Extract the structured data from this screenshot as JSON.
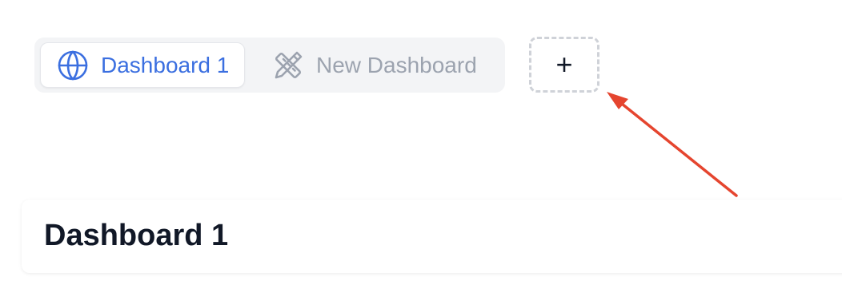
{
  "tabs": [
    {
      "label": "Dashboard 1",
      "icon": "globe-icon",
      "active": true
    },
    {
      "label": "New Dashboard",
      "icon": "pencil-ruler-icon",
      "active": false
    }
  ],
  "add_button": {
    "label": "+"
  },
  "page": {
    "title": "Dashboard 1"
  },
  "colors": {
    "accent": "#3b6fe0",
    "inactive_text": "#9ca3af",
    "annotation_arrow": "#e5452f"
  }
}
